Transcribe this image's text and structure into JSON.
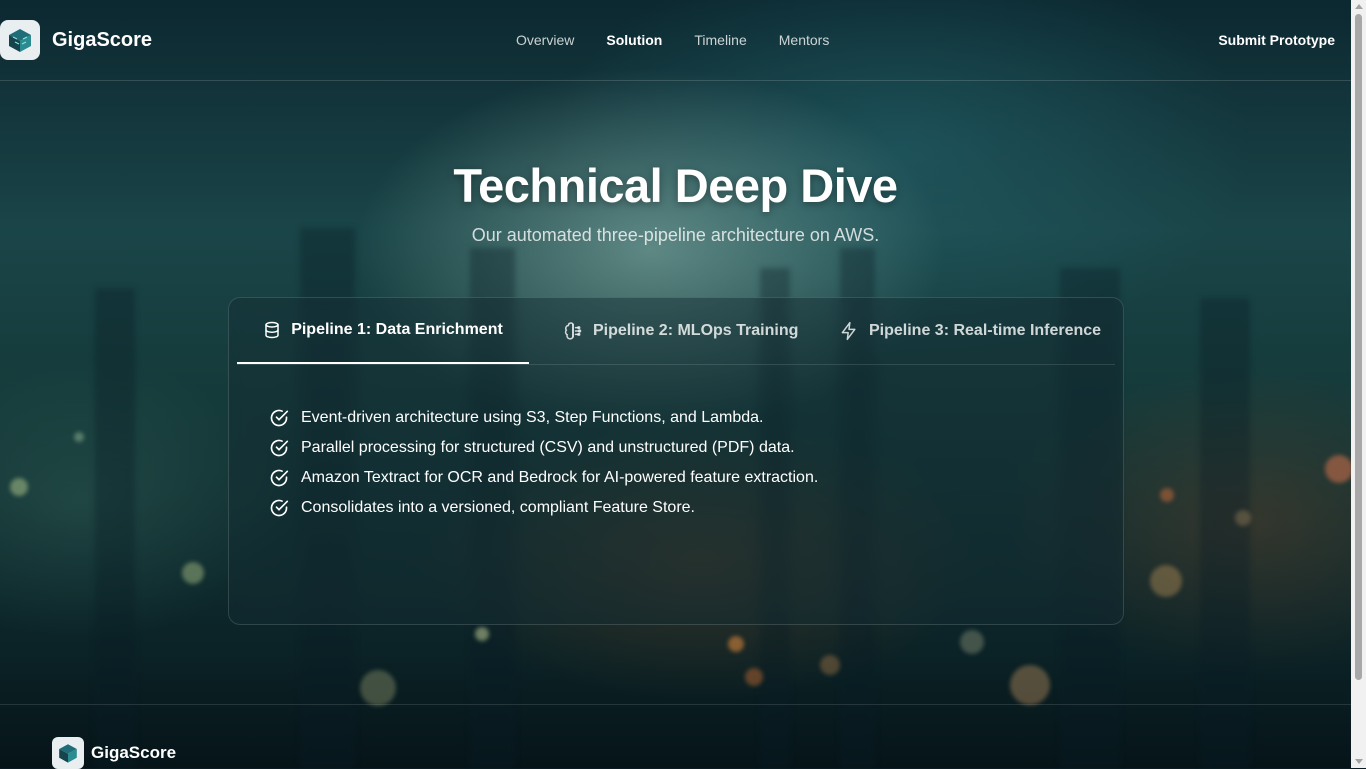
{
  "header": {
    "brand": "GigaScore",
    "nav": [
      {
        "label": "Overview",
        "active": false
      },
      {
        "label": "Solution",
        "active": true
      },
      {
        "label": "Timeline",
        "active": false
      },
      {
        "label": "Mentors",
        "active": false
      }
    ],
    "cta": "Submit Prototype"
  },
  "hero": {
    "title": "Technical Deep Dive",
    "subtitle": "Our automated three-pipeline architecture on AWS."
  },
  "tabs": [
    {
      "label": "Pipeline 1: Data Enrichment",
      "icon": "database-icon",
      "active": true
    },
    {
      "label": "Pipeline 2: MLOps Training",
      "icon": "brain-icon",
      "active": false
    },
    {
      "label": "Pipeline 3: Real-time Inference",
      "icon": "zap-icon",
      "active": false
    }
  ],
  "features": [
    "Event-driven architecture using S3, Step Functions, and Lambda.",
    "Parallel processing for structured (CSV) and unstructured (PDF) data.",
    "Amazon Textract for OCR and Bedrock for AI-powered feature extraction.",
    "Consolidates into a versioned, compliant Feature Store."
  ],
  "footer": {
    "brand": "GigaScore"
  },
  "colors": {
    "accent": "#ffffff",
    "background": "#0a1c22"
  }
}
